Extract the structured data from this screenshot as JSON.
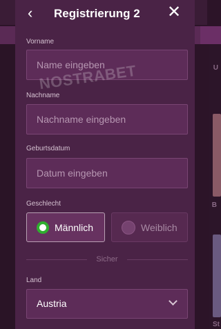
{
  "header": {
    "title": "Registrierung 2",
    "back_icon": "chevron-left-icon",
    "close_icon": "close-icon",
    "ghost_step": "2"
  },
  "watermark": "NOSTRABET",
  "fields": {
    "first_name": {
      "label": "Vorname",
      "placeholder": "Name eingeben",
      "value": ""
    },
    "last_name": {
      "label": "Nachname",
      "placeholder": "Nachname eingeben",
      "value": ""
    },
    "birth_date": {
      "label": "Geburtsdatum",
      "placeholder": "Datum eingeben",
      "value": ""
    }
  },
  "gender": {
    "label": "Geschlecht",
    "options": [
      {
        "label": "Männlich",
        "selected": true
      },
      {
        "label": "Weiblich",
        "selected": false
      }
    ]
  },
  "divider": {
    "label": "Sicher"
  },
  "country": {
    "label": "Land",
    "value": "Austria"
  },
  "background": {
    "edge_letters": [
      "U",
      "B",
      "St"
    ]
  },
  "colors": {
    "modal_bg": "#4a2346",
    "radio_selected": "#2fae2f",
    "input_bg": "#5d2c58"
  }
}
